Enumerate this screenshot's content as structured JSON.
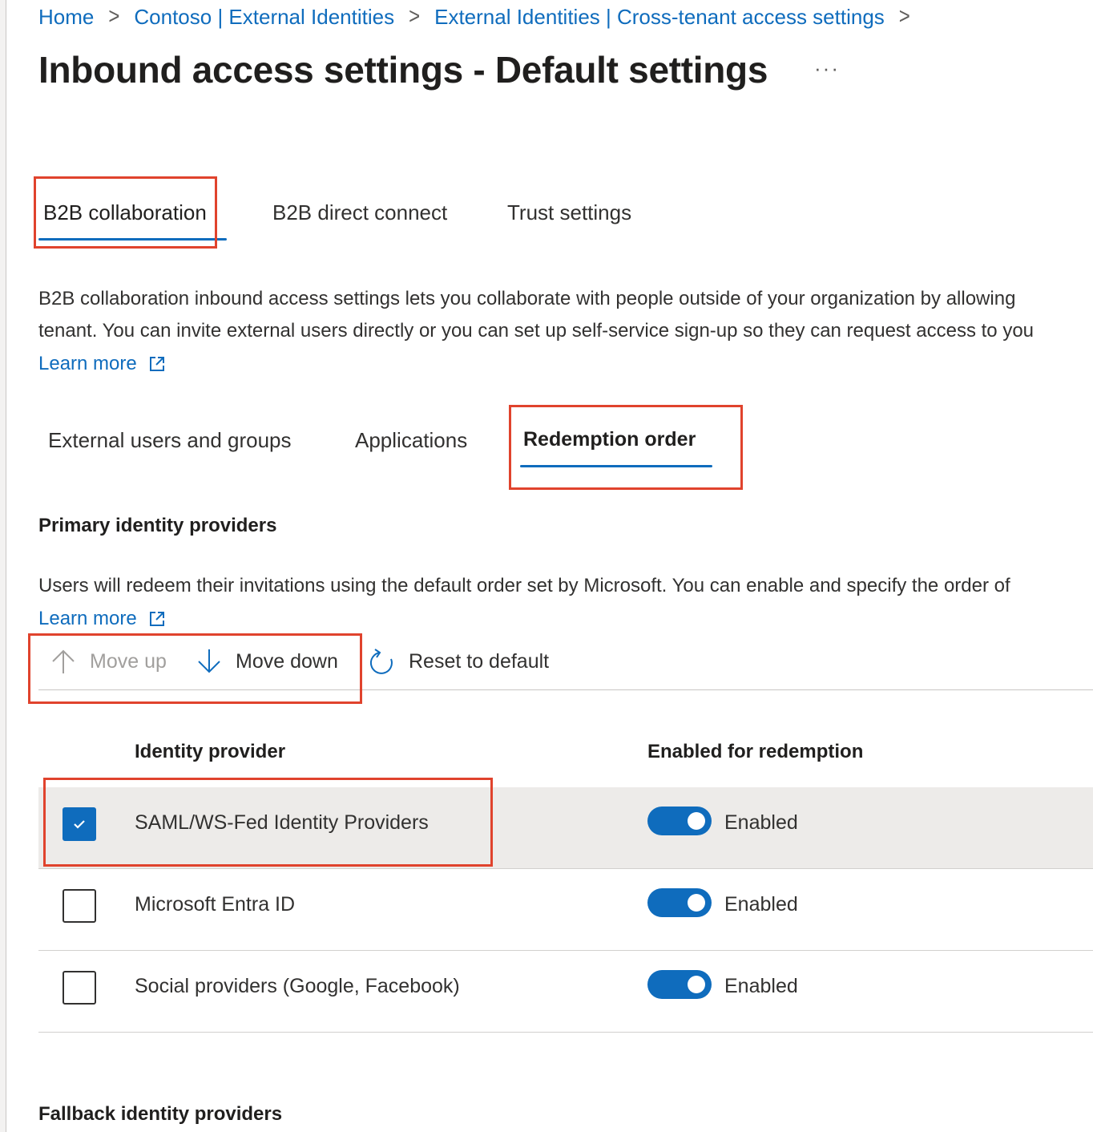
{
  "breadcrumb": {
    "items": [
      "Home",
      "Contoso | External Identities",
      "External Identities | Cross-tenant access settings"
    ],
    "separator": ">"
  },
  "page": {
    "title": "Inbound access settings - Default settings",
    "more_label": "···"
  },
  "top_tabs": {
    "items": [
      "B2B collaboration",
      "B2B direct connect",
      "Trust settings"
    ],
    "active": "B2B collaboration"
  },
  "description": {
    "line1": "B2B collaboration inbound access settings lets you collaborate with people outside of your organization by allowing",
    "line2": "tenant. You can invite external users directly or you can set up self-service sign-up so they can request access to you",
    "learn_more": "Learn more"
  },
  "sub_tabs": {
    "items": [
      "External users and groups",
      "Applications",
      "Redemption order"
    ],
    "active": "Redemption order"
  },
  "primary": {
    "title": "Primary identity providers",
    "description": "Users will redeem their invitations using the default order set by Microsoft. You can enable and specify the order of",
    "learn_more": "Learn more"
  },
  "toolbar": {
    "move_up": "Move up",
    "move_down": "Move down",
    "reset": "Reset to default"
  },
  "table": {
    "col_provider": "Identity provider",
    "col_enabled": "Enabled for redemption",
    "rows": [
      {
        "provider": "SAML/WS-Fed Identity Providers",
        "status": "Enabled",
        "selected": true
      },
      {
        "provider": "Microsoft Entra ID",
        "status": "Enabled",
        "selected": false
      },
      {
        "provider": "Social providers (Google, Facebook)",
        "status": "Enabled",
        "selected": false
      }
    ]
  },
  "fallback": {
    "title": "Fallback identity providers"
  },
  "colors": {
    "accent": "#0f6cbd",
    "highlight_box": "#e0432d",
    "selected_row": "#edebe9"
  }
}
